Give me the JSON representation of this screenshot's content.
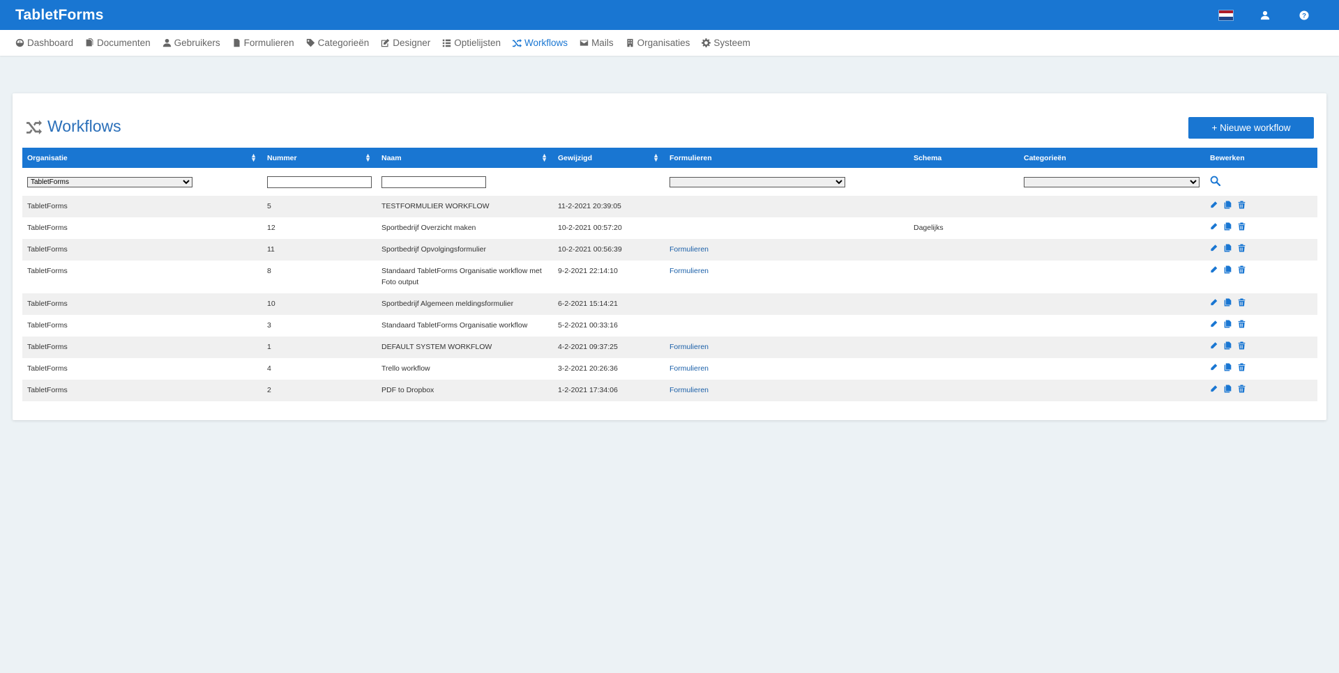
{
  "app": {
    "brand": "TabletForms"
  },
  "topbar": {
    "icons": [
      "flag-nl-icon",
      "user-icon",
      "help-icon"
    ],
    "flag_colors": [
      "#ae1c28",
      "#ffffff",
      "#21468b"
    ]
  },
  "nav": {
    "items": [
      {
        "label": "Dashboard",
        "icon": "dashboard-icon"
      },
      {
        "label": "Documenten",
        "icon": "documents-icon"
      },
      {
        "label": "Gebruikers",
        "icon": "user-icon"
      },
      {
        "label": "Formulieren",
        "icon": "file-icon"
      },
      {
        "label": "Categorieën",
        "icon": "tag-icon"
      },
      {
        "label": "Designer",
        "icon": "edit-icon"
      },
      {
        "label": "Optielijsten",
        "icon": "list-icon"
      },
      {
        "label": "Workflows",
        "icon": "shuffle-icon",
        "active": true
      },
      {
        "label": "Mails",
        "icon": "mail-icon"
      },
      {
        "label": "Organisaties",
        "icon": "building-icon"
      },
      {
        "label": "Systeem",
        "icon": "gear-icon"
      }
    ]
  },
  "page": {
    "title": "Workflows",
    "new_button": "+ Nieuwe workflow"
  },
  "table": {
    "columns": [
      "Organisatie",
      "Nummer",
      "Naam",
      "Gewijzigd",
      "Formulieren",
      "Schema",
      "Categorieën",
      "Bewerken"
    ],
    "filters": {
      "organisatie_selected": "TabletForms",
      "nummer_value": "",
      "naam_value": "",
      "formulieren_selected": "",
      "categorieen_selected": ""
    },
    "rows": [
      {
        "organisatie": "TabletForms",
        "nummer": "5",
        "naam": "TESTFORMULIER WORKFLOW",
        "gewijzigd": "11-2-2021 20:39:05",
        "formulieren": "",
        "schema": ""
      },
      {
        "organisatie": "TabletForms",
        "nummer": "12",
        "naam": "Sportbedrijf Overzicht maken",
        "gewijzigd": "10-2-2021 00:57:20",
        "formulieren": "",
        "schema": "Dagelijks"
      },
      {
        "organisatie": "TabletForms",
        "nummer": "11",
        "naam": "Sportbedrijf Opvolgingsformulier",
        "gewijzigd": "10-2-2021 00:56:39",
        "formulieren": "Formulieren",
        "schema": ""
      },
      {
        "organisatie": "TabletForms",
        "nummer": "8",
        "naam": "Standaard TabletForms Organisatie workflow met Foto output",
        "gewijzigd": "9-2-2021 22:14:10",
        "formulieren": "Formulieren",
        "schema": ""
      },
      {
        "organisatie": "TabletForms",
        "nummer": "10",
        "naam": "Sportbedrijf Algemeen meldingsformulier",
        "gewijzigd": "6-2-2021 15:14:21",
        "formulieren": "",
        "schema": ""
      },
      {
        "organisatie": "TabletForms",
        "nummer": "3",
        "naam": "Standaard TabletForms Organisatie workflow",
        "gewijzigd": "5-2-2021 00:33:16",
        "formulieren": "",
        "schema": ""
      },
      {
        "organisatie": "TabletForms",
        "nummer": "1",
        "naam": "DEFAULT SYSTEM WORKFLOW",
        "gewijzigd": "4-2-2021 09:37:25",
        "formulieren": "Formulieren",
        "schema": ""
      },
      {
        "organisatie": "TabletForms",
        "nummer": "4",
        "naam": "Trello workflow",
        "gewijzigd": "3-2-2021 20:26:36",
        "formulieren": "Formulieren",
        "schema": ""
      },
      {
        "organisatie": "TabletForms",
        "nummer": "2",
        "naam": "PDF to Dropbox",
        "gewijzigd": "1-2-2021 17:34:06",
        "formulieren": "Formulieren",
        "schema": ""
      }
    ]
  },
  "colors": {
    "primary": "#1976d2",
    "background": "#ecf2f5",
    "title": "#2a6fb9"
  }
}
